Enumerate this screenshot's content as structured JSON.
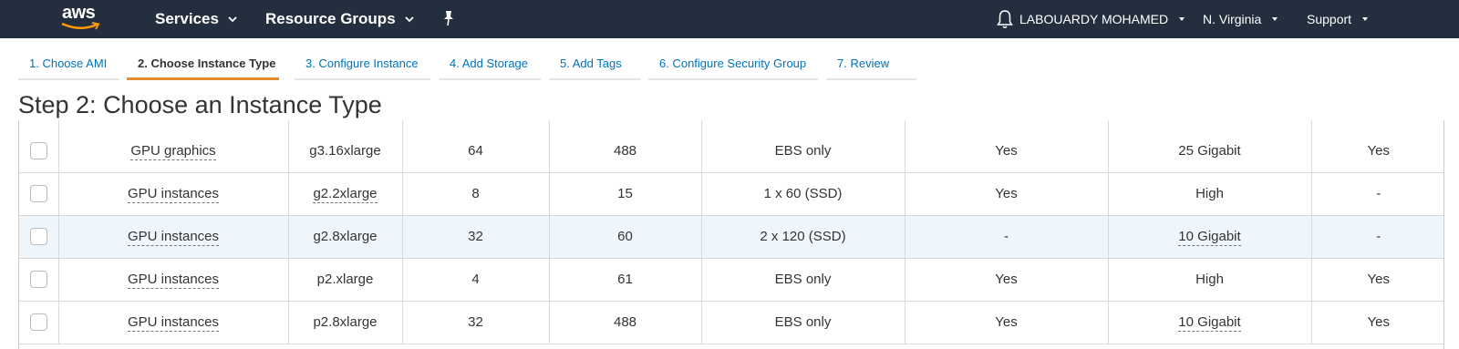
{
  "header": {
    "logo_text": "aws",
    "services_label": "Services",
    "resource_groups_label": "Resource Groups",
    "user_label": "LABOUARDY MOHAMED",
    "region_label": "N. Virginia",
    "support_label": "Support",
    "bg_color": "#232f3e",
    "icons": [
      "caret-down-icon",
      "pin-icon",
      "bell-icon"
    ]
  },
  "wizard": {
    "tabs": [
      {
        "label": "1. Choose AMI"
      },
      {
        "label": "2. Choose Instance Type"
      },
      {
        "label": "3. Configure Instance"
      },
      {
        "label": "4. Add Storage"
      },
      {
        "label": "5. Add Tags"
      },
      {
        "label": "6. Configure Security Group"
      },
      {
        "label": "7. Review"
      }
    ],
    "active_tab_index": 1,
    "active_color": "#e58a2d",
    "link_color": "#0073bb"
  },
  "page": {
    "title": "Step 2: Choose an Instance Type"
  },
  "table": {
    "rows": [
      {
        "family": "GPU graphics",
        "type": "g3.16xlarge",
        "vcpus": "64",
        "memory": "488",
        "storage": "EBS only",
        "ebs_optimized": "Yes",
        "network": "25 Gigabit",
        "ipv6": "Yes",
        "highlighted": false,
        "type_dashed": false,
        "network_dashed": false
      },
      {
        "family": "GPU instances",
        "type": "g2.2xlarge",
        "vcpus": "8",
        "memory": "15",
        "storage": "1 x 60 (SSD)",
        "ebs_optimized": "Yes",
        "network": "High",
        "ipv6": "-",
        "highlighted": false,
        "type_dashed": true,
        "network_dashed": false
      },
      {
        "family": "GPU instances",
        "type": "g2.8xlarge",
        "vcpus": "32",
        "memory": "60",
        "storage": "2 x 120 (SSD)",
        "ebs_optimized": "-",
        "network": "10 Gigabit",
        "ipv6": "-",
        "highlighted": true,
        "type_dashed": false,
        "network_dashed": true
      },
      {
        "family": "GPU instances",
        "type": "p2.xlarge",
        "vcpus": "4",
        "memory": "61",
        "storage": "EBS only",
        "ebs_optimized": "Yes",
        "network": "High",
        "ipv6": "Yes",
        "highlighted": false,
        "type_dashed": false,
        "network_dashed": false
      },
      {
        "family": "GPU instances",
        "type": "p2.8xlarge",
        "vcpus": "32",
        "memory": "488",
        "storage": "EBS only",
        "ebs_optimized": "Yes",
        "network": "10 Gigabit",
        "ipv6": "Yes",
        "highlighted": false,
        "type_dashed": false,
        "network_dashed": true
      }
    ],
    "highlight_color": "#eef6fc"
  }
}
